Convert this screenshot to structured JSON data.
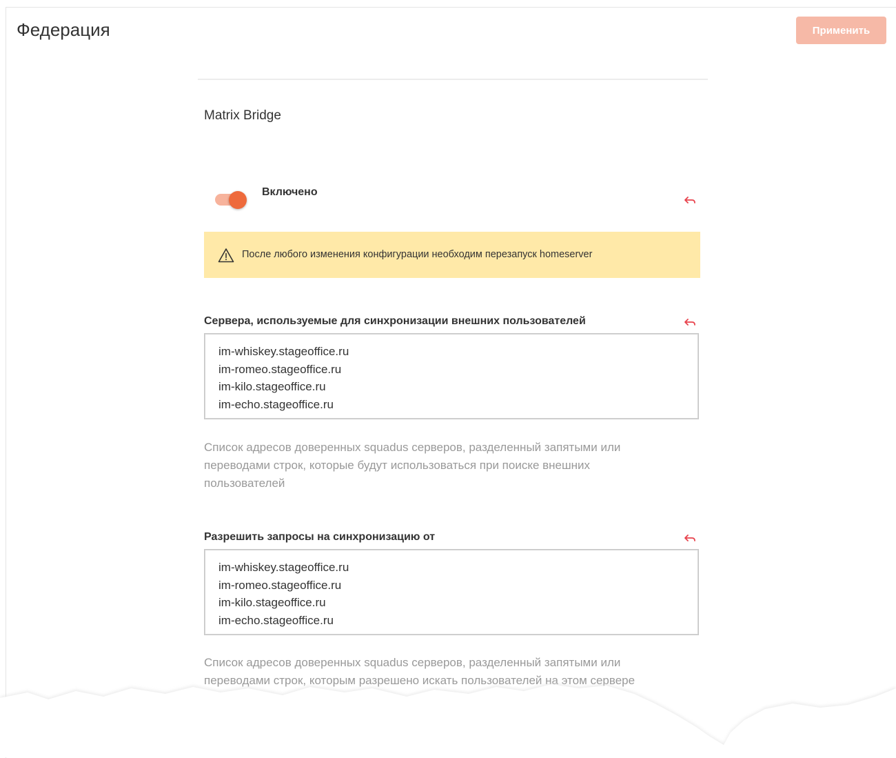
{
  "header": {
    "title": "Федерация",
    "apply_label": "Применить"
  },
  "section": {
    "title": "Matrix Bridge"
  },
  "toggle": {
    "label": "Включено",
    "state": "on"
  },
  "alert": {
    "icon": "warning-icon",
    "text": "После любого изменения конфигурации необходим перезапуск homeserver"
  },
  "sync_servers": {
    "label": "Сервера, используемые для синхронизации внешних пользователей",
    "lines": [
      "im-whiskey.stageoffice.ru",
      "im-romeo.stageoffice.ru",
      "im-kilo.stageoffice.ru",
      "im-echo.stageoffice.ru"
    ],
    "hint_lines": [
      "Список адресов доверенных squadus серверов, разделенный запятыми или",
      "переводами строк, которые будут использоваться при поиске внешних",
      "пользователей"
    ]
  },
  "allow_requests": {
    "label": "Разрешить запросы на синхронизацию от",
    "lines": [
      "im-whiskey.stageoffice.ru",
      "im-romeo.stageoffice.ru",
      "im-kilo.stageoffice.ru",
      "im-echo.stageoffice.ru"
    ],
    "hint_lines": [
      "Список адресов доверенных squadus серверов, разделенный запятыми или",
      "переводами строк, которым разрешено искать пользователей на этом сервере"
    ]
  },
  "colors": {
    "accent": "#ee6a3c",
    "apply_disabled": "#f6b9a7",
    "reset_icon": "#e8424c",
    "alert_bg": "#ffe9a8"
  }
}
